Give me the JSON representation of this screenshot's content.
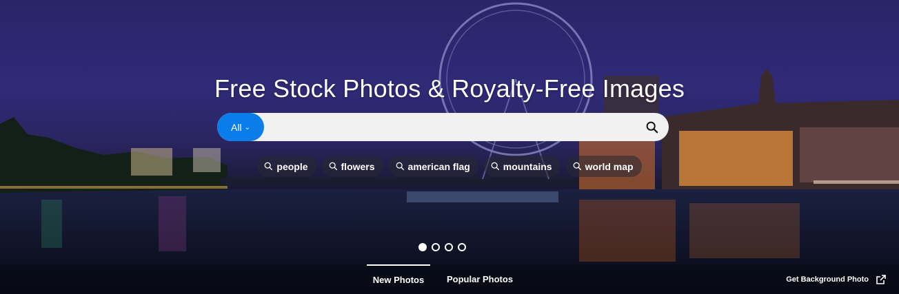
{
  "hero": {
    "title": "Free Stock Photos & Royalty-Free Images"
  },
  "search": {
    "category_label": "All",
    "category_icon": "chevron-down-icon",
    "placeholder": "",
    "value": "",
    "submit_icon": "search-icon"
  },
  "tags": [
    {
      "label": "people"
    },
    {
      "label": "flowers"
    },
    {
      "label": "american flag"
    },
    {
      "label": "mountains"
    },
    {
      "label": "world map"
    }
  ],
  "carousel": {
    "slides": 4,
    "active": 1
  },
  "bottom_nav": {
    "tabs": [
      {
        "label": "New Photos",
        "active": true
      },
      {
        "label": "Popular Photos",
        "active": false
      }
    ],
    "get_background_label": "Get Background Photo",
    "get_background_icon": "external-link-icon"
  },
  "colors": {
    "accent": "#0b7dea",
    "search_bg": "#f1f1f1"
  }
}
